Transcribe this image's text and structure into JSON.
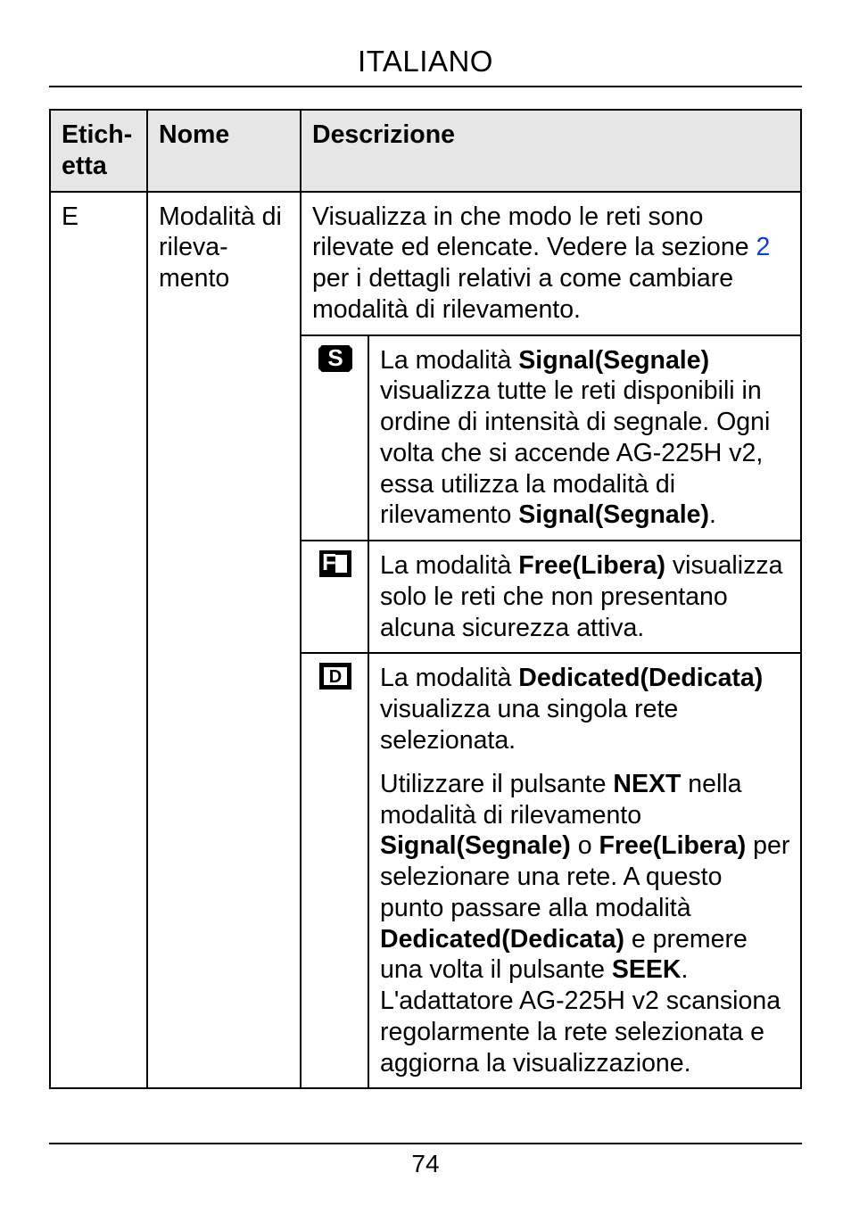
{
  "header": {
    "title": "ITALIANO"
  },
  "footer": {
    "page": "74"
  },
  "table": {
    "head": {
      "c1": "Etich­etta",
      "c2": "Nome",
      "c3": "Descrizione"
    },
    "row_e": {
      "etich": "E",
      "nome": "Modalità di rileva-mento",
      "desc_pre": "Visualizza in che modo le reti sono rilevate ed elencate. Vedere la sezione ",
      "desc_link": "2",
      "desc_post": " per i dettagli relativi a come cambiare modalità di rilevamento."
    },
    "sub": {
      "s": {
        "letter": "S",
        "p1a": "La modalità ",
        "b1": "Signal(Segnale)",
        "p1b": " visualizza tutte le reti disponibili in ordine di intensità di segnale. Ogni volta che si accende AG-225H v2, essa utilizza la modalità di rilevamento ",
        "b2": "Signal(Segnale)",
        "p1c": "."
      },
      "f": {
        "letter": "F",
        "p1a": "La modalità ",
        "b1": "Free(Libera)",
        "p1b": " visualizza solo le reti che non presentano alcuna sicurezza attiva."
      },
      "d": {
        "letter": "D",
        "p1a": "La modalità ",
        "b1": "Dedicated(Dedicata)",
        "p1b": " visualizza una singola rete selezionata.",
        "p2a": "Utilizzare il pulsante ",
        "b2": "NEXT",
        "p2b": " nella modalità di rilevamento ",
        "b3": "Signal(Segnale)",
        "p2c": " o ",
        "b4": "Free(Libera)",
        "p2d": " per selezionare una rete. A questo punto passare alla modalità ",
        "b5": "Dedicated(Dedicata)",
        "p2e": " e premere una volta il pulsante ",
        "b6": "SEEK",
        "p2f": ". L'adattatore AG-225H v2 scansiona regolarmente la rete selezionata e aggiorna la visualizzazione."
      }
    }
  }
}
